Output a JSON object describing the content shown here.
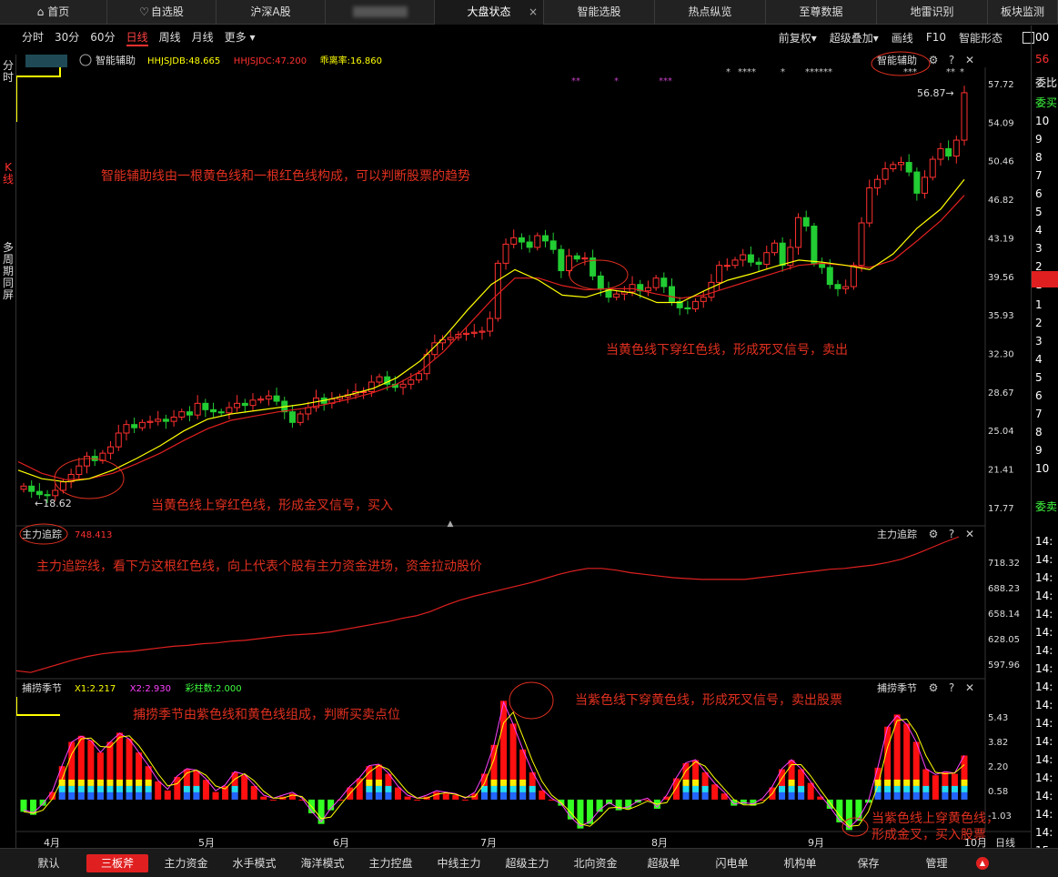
{
  "tabs": [
    {
      "label": "首页",
      "icon": "home-icon"
    },
    {
      "label": "自选股",
      "icon": "heart-icon"
    },
    {
      "label": "沪深A股"
    },
    {
      "label": ""
    },
    {
      "label": "大盘状态",
      "close": "×"
    },
    {
      "label": "智能选股"
    },
    {
      "label": "热点纵览"
    },
    {
      "label": "至尊数据"
    },
    {
      "label": "地雷识别"
    },
    {
      "label": "板块监测"
    }
  ],
  "left_tabs": [
    "分时",
    "K线",
    "多周期同屏"
  ],
  "toolbar": {
    "periods": [
      "分时",
      "30分",
      "60分",
      "日线",
      "周线",
      "月线",
      "更多 ▾"
    ],
    "active_period": "日线",
    "right": [
      "前复权▾",
      "超级叠加▾",
      "画线",
      "F10",
      "智能形态"
    ]
  },
  "panel1": {
    "name": "智能辅助",
    "readouts": [
      {
        "label": "HHJSJDB:48.665",
        "color": "#ffff00"
      },
      {
        "label": "HHJSJDC:47.200",
        "color": "#ff3030"
      },
      {
        "label": "乖离率:16.860",
        "color": "#ffff00"
      }
    ],
    "right_label": "智能辅助",
    "axis": [
      "57.72",
      "54.09",
      "50.46",
      "46.82",
      "43.19",
      "39.56",
      "35.93",
      "32.30",
      "28.67",
      "25.04",
      "21.41",
      "17.77"
    ],
    "low_label": "←18.62",
    "high_label": "56.87→",
    "note1": "智能辅助线由一根黄色线和一根红色线构成，可以判断股票的趋势",
    "note2": "当黄色线下穿红色线，形成死叉信号，卖出",
    "note3": "当黄色线上穿红色线，形成金叉信号，买入"
  },
  "panel2": {
    "name": "主力追踪",
    "value": "748.413",
    "right_label": "主力追踪",
    "axis": [
      "718.32",
      "688.23",
      "658.14",
      "628.05",
      "597.96"
    ],
    "note": "主力追踪线，看下方这根红色线，向上代表个股有主力资金进场，资金拉动股价"
  },
  "panel3": {
    "name": "捕捞季节",
    "readouts": [
      {
        "label": "X1:2.217",
        "color": "#ffff00"
      },
      {
        "label": "X2:2.930",
        "color": "#ff40ff"
      },
      {
        "label": "彩柱数:2.000",
        "color": "#40ff40"
      }
    ],
    "right_label": "捕捞季节",
    "axis": [
      "5.43",
      "3.82",
      "2.20",
      "0.58",
      "-1.03"
    ],
    "note1": "捕捞季节由紫色线和黄色线组成，判断买卖点位",
    "note2": "当紫色线下穿黄色线，形成死叉信号，卖出股票",
    "note3a": "当紫色线上穿黄色线，",
    "note3b": "形成金叉，买入股票"
  },
  "months": [
    "4月",
    "5月",
    "6月",
    "7月",
    "8月",
    "9月",
    "10月"
  ],
  "period_label": "日线",
  "bottom": [
    "默认",
    "三板斧",
    "主力资金",
    "水手模式",
    "海洋模式",
    "主力控盘",
    "中线主力",
    "超级主力",
    "北向资金",
    "超级单",
    "闪电单",
    "机构单",
    "保存",
    "管理"
  ],
  "bottom_active": "三板斧",
  "right_strip": [
    "00",
    "56",
    "委比",
    "委买",
    "10",
    "9",
    "8",
    "7",
    "6",
    "5",
    "4",
    "3",
    "2",
    "1",
    "1",
    "2",
    "3",
    "4",
    "5",
    "6",
    "7",
    "8",
    "9",
    "10",
    "委卖",
    "14:",
    "14:",
    "14:",
    "14:",
    "14:",
    "14:",
    "14:",
    "14:",
    "14:",
    "14:",
    "14:",
    "14:",
    "14:",
    "14:",
    "14:",
    "14:",
    "14:",
    "15:"
  ],
  "chart_data": {
    "type": "candlestick",
    "price_range": [
      17.77,
      57.72
    ],
    "closes": [
      19.8,
      19.3,
      19.0,
      18.9,
      19.4,
      20.2,
      20.9,
      21.7,
      22.6,
      22.2,
      22.9,
      23.5,
      24.8,
      25.6,
      25.3,
      25.8,
      25.9,
      26.1,
      25.9,
      26.3,
      26.8,
      26.5,
      27.6,
      27.0,
      26.8,
      26.7,
      27.2,
      27.6,
      27.4,
      27.9,
      28.0,
      28.3,
      27.8,
      26.8,
      25.8,
      26.6,
      27.2,
      28.1,
      27.6,
      28.0,
      28.2,
      28.4,
      28.7,
      28.7,
      29.6,
      30.1,
      29.4,
      29.1,
      29.4,
      29.8,
      30.4,
      32.2,
      33.3,
      33.6,
      33.8,
      34.1,
      34.2,
      34.3,
      34.4,
      35.6,
      40.8,
      42.6,
      43.2,
      42.8,
      42.3,
      43.4,
      42.9,
      42.1,
      40.1,
      41.5,
      41.2,
      41.3,
      39.6,
      38.4,
      37.6,
      37.9,
      38.1,
      38.8,
      38.2,
      38.5,
      39.4,
      38.6,
      37.2,
      36.6,
      36.5,
      37.2,
      37.6,
      39.0,
      40.6,
      40.6,
      41.1,
      41.6,
      40.9,
      40.7,
      41.8,
      42.7,
      40.6,
      42.3,
      45.1,
      44.3,
      40.8,
      40.4,
      38.8,
      38.4,
      38.6,
      40.6,
      44.6,
      47.9,
      48.7,
      49.7,
      50.1,
      50.3,
      49.4,
      47.4,
      48.9,
      50.6,
      51.6,
      50.9,
      52.4,
      56.87
    ],
    "yellow_line": [
      21.3,
      20.5,
      20.2,
      20.5,
      21.3,
      22.4,
      23.6,
      25.0,
      26.1,
      26.6,
      26.9,
      27.2,
      27.5,
      27.9,
      28.4,
      29.0,
      30.0,
      31.6,
      33.8,
      36.4,
      38.8,
      40.2,
      39.2,
      37.8,
      37.6,
      38.3,
      38.0,
      37.1,
      37.1,
      38.2,
      39.2,
      39.8,
      40.5,
      41.1,
      40.9,
      40.6,
      40.2,
      41.7,
      44.1,
      45.9,
      48.7
    ],
    "red_line": [
      22.1,
      21.0,
      20.4,
      20.5,
      21.0,
      21.9,
      22.9,
      24.1,
      25.2,
      26.0,
      26.4,
      26.8,
      27.1,
      27.5,
      28.0,
      28.6,
      29.4,
      30.6,
      32.5,
      34.9,
      37.3,
      39.4,
      39.4,
      38.7,
      38.3,
      38.4,
      38.4,
      37.9,
      37.5,
      37.8,
      38.5,
      39.2,
      39.9,
      40.6,
      40.8,
      40.6,
      40.4,
      41.1,
      42.9,
      44.8,
      47.2
    ],
    "main_force_range": [
      585,
      748.413
    ],
    "main_force": [
      590,
      588,
      593,
      598,
      603,
      607,
      610,
      612,
      613,
      615,
      617,
      619,
      620,
      622,
      623,
      625,
      626,
      628,
      630,
      632,
      633,
      634,
      636,
      639,
      642,
      645,
      648,
      652,
      655,
      660,
      667,
      673,
      678,
      682,
      686,
      690,
      694,
      699,
      704,
      708,
      711,
      711,
      709,
      706,
      704,
      702,
      700,
      699,
      698,
      698,
      698,
      698,
      700,
      702,
      704,
      706,
      708,
      710,
      711,
      713,
      715,
      718,
      722,
      728,
      735,
      742,
      748.413
    ],
    "season_range": [
      -1.8,
      7.0
    ],
    "season": [
      -0.8,
      -1.0,
      -0.4,
      0.5,
      2.2,
      3.8,
      4.2,
      3.9,
      3.1,
      3.8,
      4.4,
      4.0,
      3.1,
      2.2,
      1.2,
      0.6,
      1.5,
      2.0,
      1.9,
      1.3,
      0.5,
      0.9,
      1.8,
      1.6,
      0.9,
      0.2,
      0.0,
      0.2,
      0.4,
      0.0,
      -0.9,
      -1.6,
      -0.7,
      0.0,
      0.8,
      1.4,
      2.2,
      2.3,
      1.7,
      0.8,
      0.2,
      0.0,
      0.2,
      0.5,
      0.4,
      0.3,
      0.0,
      0.4,
      1.7,
      3.6,
      6.5,
      5.0,
      3.3,
      1.8,
      0.6,
      0.0,
      -0.4,
      -1.3,
      -1.9,
      -1.6,
      -0.8,
      -0.3,
      -0.7,
      -0.6,
      -0.2,
      0.0,
      -0.6,
      0.2,
      1.4,
      2.4,
      2.6,
      1.8,
      1.0,
      0.4,
      -0.4,
      -0.3,
      -0.4,
      0.0,
      0.8,
      2.0,
      2.6,
      2.0,
      1.1,
      0.2,
      -0.6,
      -1.5,
      -2.0,
      -1.4,
      -0.2,
      2.1,
      4.8,
      5.6,
      5.0,
      3.8,
      2.0,
      1.6,
      1.8,
      1.7,
      2.9
    ]
  }
}
